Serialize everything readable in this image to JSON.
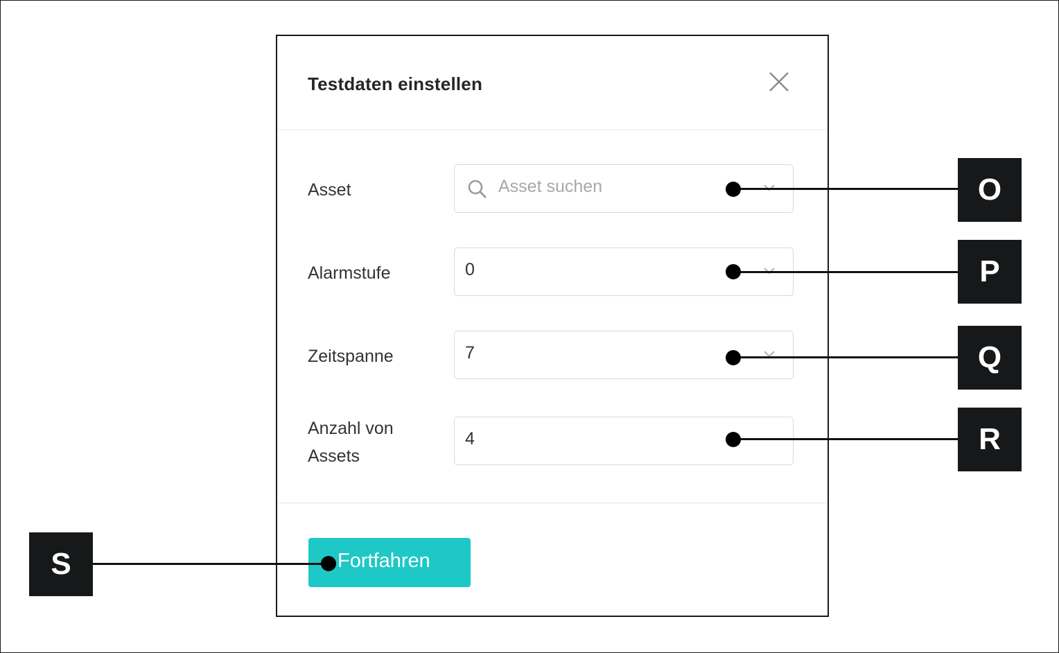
{
  "dialog": {
    "title": "Testdaten einstellen",
    "fields": [
      {
        "label": "Asset",
        "placeholder": "Asset suchen",
        "type": "search-select"
      },
      {
        "label": "Alarmstufe",
        "value": "0",
        "type": "select"
      },
      {
        "label": "Zeitspanne",
        "value": "7",
        "type": "select"
      },
      {
        "label": "Anzahl von Assets",
        "value": "4",
        "type": "number"
      }
    ],
    "submit_label": "Fortfahren"
  },
  "callouts": [
    "O",
    "P",
    "Q",
    "R",
    "S"
  ],
  "colors": {
    "accent": "#1ec8c6",
    "badge": "#17181a"
  }
}
